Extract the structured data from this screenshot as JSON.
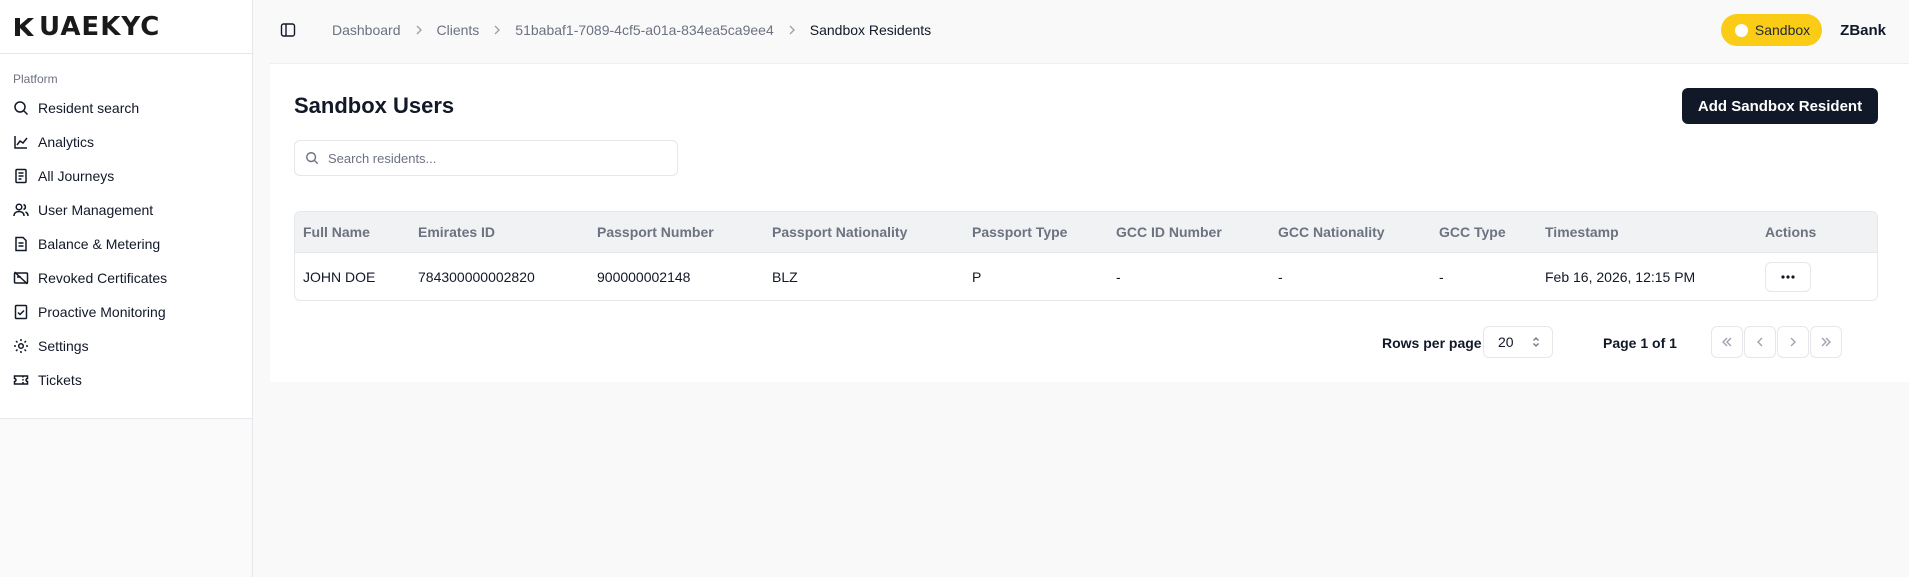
{
  "brand": {
    "logo_text": "UAEKYC"
  },
  "sidebar": {
    "group_label": "Platform",
    "items": [
      {
        "label": "Resident search",
        "icon": "search-icon"
      },
      {
        "label": "Analytics",
        "icon": "chart-line-icon"
      },
      {
        "label": "All Journeys",
        "icon": "journeys-icon"
      },
      {
        "label": "User Management",
        "icon": "users-icon"
      },
      {
        "label": "Balance & Metering",
        "icon": "document-icon"
      },
      {
        "label": "Revoked Certificates",
        "icon": "revoked-icon"
      },
      {
        "label": "Proactive Monitoring",
        "icon": "clipboard-check-icon"
      },
      {
        "label": "Settings",
        "icon": "gear-icon"
      },
      {
        "label": "Tickets",
        "icon": "ticket-icon"
      }
    ]
  },
  "breadcrumb": {
    "items": [
      "Dashboard",
      "Clients",
      "51babaf1-7089-4cf5-a01a-834ea5ca9ee4"
    ],
    "current": "Sandbox Residents"
  },
  "header": {
    "environment_badge": "Sandbox",
    "organization": "ZBank",
    "badge_color": "#facc15"
  },
  "main": {
    "title": "Sandbox Users",
    "add_button_label": "Add Sandbox Resident",
    "search_placeholder": "Search residents...",
    "table": {
      "columns": [
        "Full Name",
        "Emirates ID",
        "Passport Number",
        "Passport Nationality",
        "Passport Type",
        "GCC ID Number",
        "GCC Nationality",
        "GCC Type",
        "Timestamp",
        "Actions"
      ],
      "rows": [
        [
          "JOHN DOE",
          "784300000002820",
          "900000002148",
          "BLZ",
          "P",
          "-",
          "-",
          "-",
          "Feb 16, 2026, 12:15 PM",
          "..."
        ]
      ]
    },
    "pagination": {
      "rows_per_page_label": "Rows per page",
      "rows_per_page_value": "20",
      "page_info": "Page 1 of 1"
    }
  }
}
